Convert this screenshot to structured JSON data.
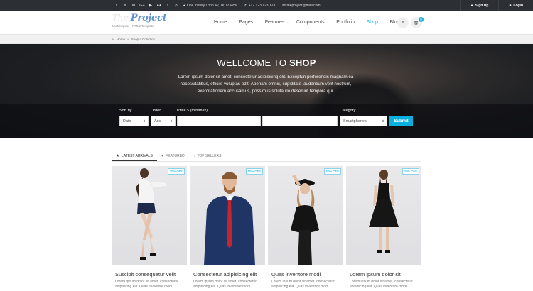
{
  "topbar": {
    "social_icons": [
      "twitter-icon",
      "skype-icon",
      "linkedin-icon",
      "google-plus-icon",
      "youtube-icon",
      "flickr-icon",
      "facebook-icon",
      "pinterest-icon"
    ],
    "social_glyphs": [
      "t",
      "s",
      "in",
      "G+",
      "▶",
      "●●",
      "f",
      "p"
    ],
    "address": "One Infinity Loop Av, Tk 123456",
    "phone": "+12 123 123 123",
    "email": "theproject@mail.com",
    "signup_label": "Sign Up",
    "login_label": "Login"
  },
  "header": {
    "logo_text_1": "The ",
    "logo_text_2": "Project",
    "tagline": "Multipurpose HTML5 Template",
    "nav": [
      {
        "label": "Home",
        "active": false
      },
      {
        "label": "Pages",
        "active": false
      },
      {
        "label": "Features",
        "active": false
      },
      {
        "label": "Components",
        "active": false
      },
      {
        "label": "Portfolio",
        "active": false
      },
      {
        "label": "Shop",
        "active": true
      },
      {
        "label": "Blog",
        "active": false
      }
    ],
    "cart_count": "0"
  },
  "breadcrumb": {
    "home": "Home",
    "current": "Shop 4 Columns"
  },
  "hero": {
    "title_light": "WELLCOME TO ",
    "title_bold": "SHOP",
    "text": "Lorem ipsum dolor sit amet, consectetur adipisicing elit. Excepturi perferendis magnam ea necessitatibus, officiis voluptas odit! Aperiam omnis, cupiditate laudantium velit nostrum, exercitationem accusamus, possimus soluta illo deserunt tempora qui."
  },
  "filters": {
    "sort_label": "Sort by",
    "sort_value": "Date",
    "order_label": "Order",
    "order_value": "Acs",
    "price_label": "Price $ (min/max)",
    "price_min": "",
    "price_max": "",
    "category_label": "Category",
    "category_value": "Smartphones",
    "submit_label": "Submit"
  },
  "tabs": [
    {
      "label": "LATEST ARRIVALS",
      "icon": "star-icon",
      "active": true
    },
    {
      "label": "FEATURED",
      "icon": "heart-icon",
      "active": false
    },
    {
      "label": "TOP SELLERS",
      "icon": "arrow-up-icon",
      "active": false
    }
  ],
  "products": [
    {
      "title": "Suscipit consequatur velit",
      "badge": "30% OFF",
      "desc": "Lorem ipsum dolor sit amet, consectetur adipisicing elit. Quas inventore modi."
    },
    {
      "title": "Consectetur adipisicing elit",
      "badge": "55% OFF",
      "desc": "Lorem ipsum dolor sit amet, consectetur adipisicing elit. Quas inventore modi."
    },
    {
      "title": "Quas inventore modi",
      "badge": "50% OFF",
      "desc": "Lorem ipsum dolor sit amet, consectetur adipisicing elit. Quas inventore modi."
    },
    {
      "title": "Lorem ipsum dolor sit",
      "badge": "20% OFF",
      "desc": "Lorem ipsum dolor sit amet, consectetur adipisicing elit. Quas inventore modi."
    }
  ],
  "colors": {
    "accent": "#09afdf",
    "topbar": "#2c2f33"
  }
}
